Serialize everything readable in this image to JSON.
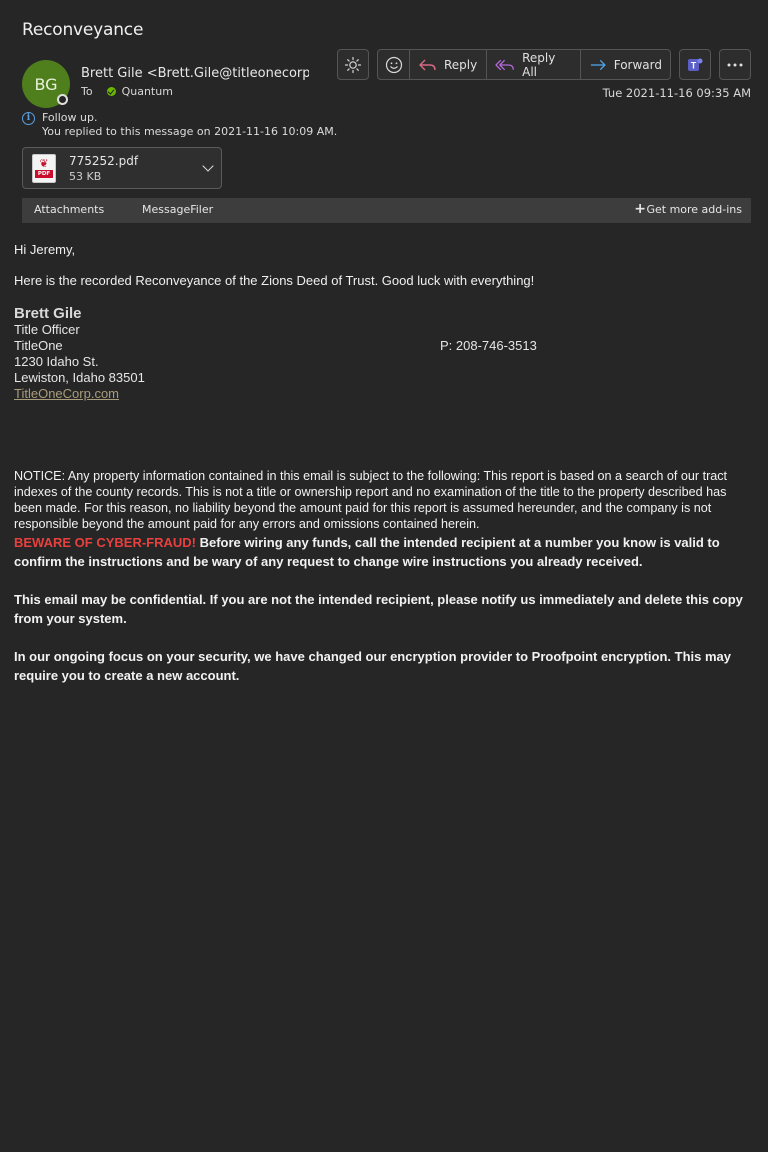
{
  "email": {
    "subject": "Reconveyance",
    "avatar_initials": "BG",
    "sender": "Brett Gile <Brett.Gile@titleonecorp",
    "to_label": "To",
    "recipient": "Quantum",
    "date": "Tue 2021-11-16 09:35 AM",
    "follow_up": "Follow up.",
    "replied_note": "You replied to this message on 2021-11-16 10:09 AM."
  },
  "toolbar": {
    "reply_label": "Reply",
    "reply_all_label": "Reply All",
    "forward_label": "Forward"
  },
  "attachment": {
    "filename": "775252.pdf",
    "size": "53 KB",
    "icon_text": "PDF"
  },
  "addins": {
    "attachments": "Attachments",
    "message_filer": "MessageFiler",
    "get_more": "Get more add-ins"
  },
  "body": {
    "greeting": "Hi Jeremy,",
    "message": "Here is the recorded Reconveyance of the Zions Deed of Trust.  Good luck with everything!",
    "signature": {
      "name": "Brett Gile",
      "title": "Title Officer",
      "company": "TitleOne",
      "phone": "P: 208-746-3513",
      "address1": "1230 Idaho St.",
      "address2": "Lewiston, Idaho 83501",
      "website": "TitleOneCorp.com"
    },
    "notice": "NOTICE: Any property information contained in this email is subject to the following: This report is based on a search of our tract indexes of the county records. This is not a title or ownership report and no examination of the title to the property described has been made. For this reason, no liability beyond the amount paid for this report is assumed hereunder, and the company is not responsible beyond the amount paid for any errors and omissions contained herein.",
    "beware": "BEWARE OF CYBER-FRAUD!",
    "wire_warning": " Before wiring any funds, call the intended recipient at a number you know is valid to confirm the instructions and be wary of any request to change wire instructions you already received.",
    "confidential": "This email may be confidential. If you are not the intended recipient, please notify us immediately and delete this copy from your system.",
    "encryption": "In our ongoing focus on your security, we have changed our encryption provider to Proofpoint encryption. This may require you to create a new account."
  },
  "colors": {
    "background": "#262626",
    "avatar": "#4f7f1d",
    "reply_icon": "#d86a84",
    "reply_all_icon": "#b46ad8",
    "forward_icon": "#4fa3e6",
    "teams": "#5b5fc7",
    "beware": "#e8403e",
    "link": "#a89c7b"
  }
}
